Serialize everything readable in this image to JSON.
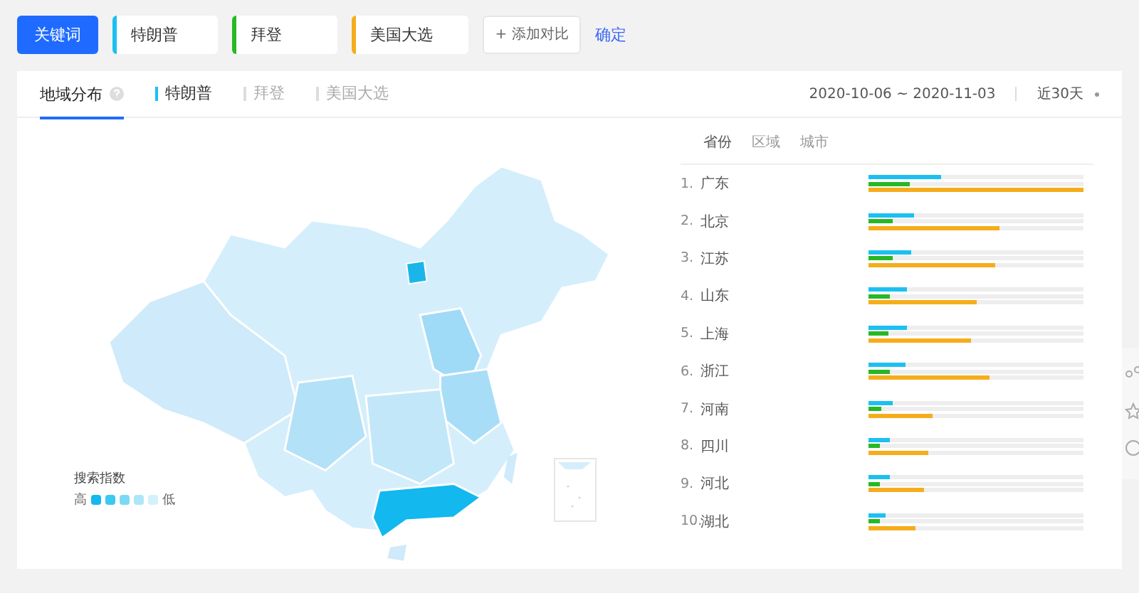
{
  "toolbar": {
    "main_button": "关键词",
    "keywords": [
      {
        "label": "特朗普",
        "color": "#1cc0f0"
      },
      {
        "label": "拜登",
        "color": "#27b825"
      },
      {
        "label": "美国大选",
        "color": "#f5ad1c"
      }
    ],
    "add_button": "+ 添加对比",
    "confirm_link": "确定"
  },
  "panel": {
    "title": "地域分布",
    "series_tabs": [
      {
        "label": "特朗普",
        "selected": true
      },
      {
        "label": "拜登",
        "selected": false
      },
      {
        "label": "美国大选",
        "selected": false
      }
    ],
    "date_range": "2020-10-06 ~ 2020-11-03",
    "period": "近30天",
    "legend": {
      "title": "搜索指数",
      "high": "高",
      "low": "低"
    },
    "ranking_tabs": [
      {
        "label": "省份",
        "selected": true
      },
      {
        "label": "区域",
        "selected": false
      },
      {
        "label": "城市",
        "selected": false
      }
    ],
    "rows": [
      {
        "rank": "1.",
        "name": "广东",
        "bars": [
          {
            "level": 0.34
          },
          {
            "level": 0.19
          },
          {
            "level": 1.0
          }
        ]
      },
      {
        "rank": "2.",
        "name": "北京",
        "bars": [
          {
            "level": 0.21
          },
          {
            "level": 0.11
          },
          {
            "level": 0.61
          }
        ]
      },
      {
        "rank": "3.",
        "name": "江苏",
        "bars": [
          {
            "level": 0.2
          },
          {
            "level": 0.11
          },
          {
            "level": 0.59
          }
        ]
      },
      {
        "rank": "4.",
        "name": "山东",
        "bars": [
          {
            "level": 0.18
          },
          {
            "level": 0.1
          },
          {
            "level": 0.5
          }
        ]
      },
      {
        "rank": "5.",
        "name": "上海",
        "bars": [
          {
            "level": 0.18
          },
          {
            "level": 0.09
          },
          {
            "level": 0.48
          }
        ]
      },
      {
        "rank": "6.",
        "name": "浙江",
        "bars": [
          {
            "level": 0.17
          },
          {
            "level": 0.1
          },
          {
            "level": 0.56
          }
        ]
      },
      {
        "rank": "7.",
        "name": "河南",
        "bars": [
          {
            "level": 0.11
          },
          {
            "level": 0.06
          },
          {
            "level": 0.3
          }
        ]
      },
      {
        "rank": "8.",
        "name": "四川",
        "bars": [
          {
            "level": 0.1
          },
          {
            "level": 0.05
          },
          {
            "level": 0.28
          }
        ]
      },
      {
        "rank": "9.",
        "name": "河北",
        "bars": [
          {
            "level": 0.1
          },
          {
            "level": 0.05
          },
          {
            "level": 0.26
          }
        ]
      },
      {
        "rank": "10.",
        "name": "湖北",
        "bars": [
          {
            "level": 0.08
          },
          {
            "level": 0.05
          },
          {
            "level": 0.22
          }
        ]
      }
    ]
  }
}
